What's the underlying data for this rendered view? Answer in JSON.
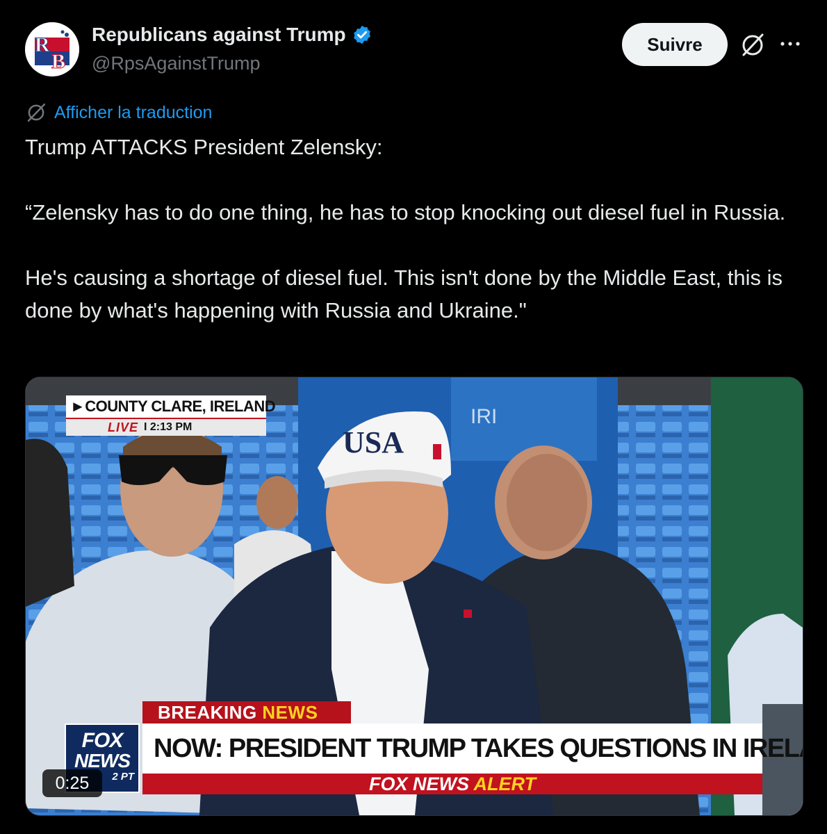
{
  "author": {
    "display_name": "Republicans against Trump",
    "handle": "@RpsAgainstTrump",
    "avatar_initials": "RB",
    "verified_color": "#1d9bf0"
  },
  "actions": {
    "follow_label": "Suivre",
    "grok_icon": "grok-slash-icon",
    "more_icon": "more-dots-icon"
  },
  "translation": {
    "label": "Afficher la traduction",
    "icon": "grok-slash-icon",
    "color": "#1d9bf0"
  },
  "tweet": {
    "line1": "Trump ATTACKS President Zelensky:",
    "para2": "“Zelensky has to do one thing, he has to stop knocking out diesel fuel in Russia.",
    "para3": "He's causing a shortage of diesel fuel. This isn't done by the Middle East, this is done by what's happening with Russia and Ukraine.\""
  },
  "video": {
    "duration": "0:25",
    "location": "►COUNTY CLARE, IRELAND",
    "live_label": "LIVE",
    "live_time": "I 2:13 PM",
    "breaking_label": "BREAKING",
    "breaking_news": "NEWS",
    "headline": "NOW: PRESIDENT TRUMP TAKES QUESTIONS IN IRELAND",
    "fox_line1": "FOX",
    "fox_line2": "NEWS",
    "fox_time": "2 PT",
    "alert_fox": "FOX NEWS",
    "alert_word": "ALERT",
    "hat_text": "USA",
    "sign_text": "IRI"
  }
}
